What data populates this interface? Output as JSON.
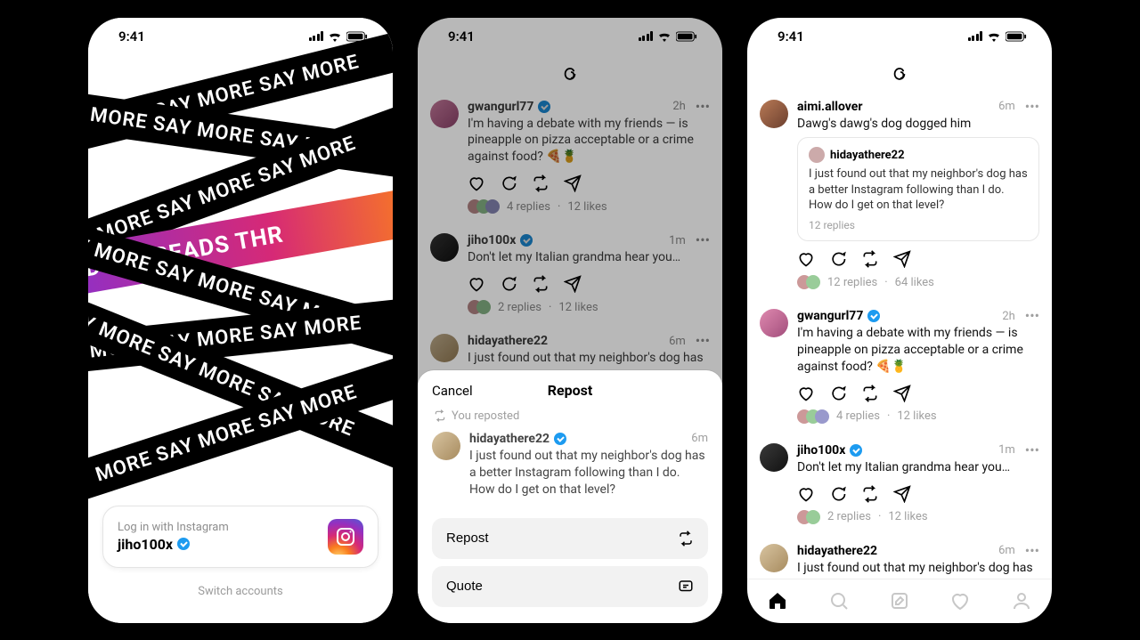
{
  "status": {
    "time": "9:41"
  },
  "ribbon": {
    "say_more": "SAY MORE  SAY MORE  SAY MORE  SAY MORE",
    "threads": "EADS THREADS THREADS THR"
  },
  "login": {
    "subtitle": "Log in with Instagram",
    "username": "jiho100x",
    "switch": "Switch accounts"
  },
  "sheet": {
    "cancel": "Cancel",
    "title": "Repost",
    "you_reposted": "You reposted",
    "repost_btn": "Repost",
    "quote_btn": "Quote"
  },
  "posts": {
    "gwangurl": {
      "user": "gwangurl77",
      "time": "2h",
      "body": "I'm having a debate with my friends — is pineapple on pizza acceptable or a crime against food? 🍕🍍",
      "replies": "4 replies",
      "likes": "12 likes"
    },
    "jiho": {
      "user": "jiho100x",
      "time": "1m",
      "body": "Don't let my Italian grandma hear you…",
      "replies": "2 replies",
      "likes": "12 likes"
    },
    "hidaya": {
      "user": "hidayathere22",
      "time": "6m",
      "body": "I just found out that my neighbor's dog has a better Instagram following than I do. How do I get on that level?",
      "body_short": "I just found out that my neighbor's dog has a",
      "replies": "12 replies"
    },
    "aimi": {
      "user": "aimi.allover",
      "time": "6m",
      "body": "Dawg's dawg's dog dogged him",
      "replies": "12 replies",
      "likes": "64 likes"
    }
  }
}
